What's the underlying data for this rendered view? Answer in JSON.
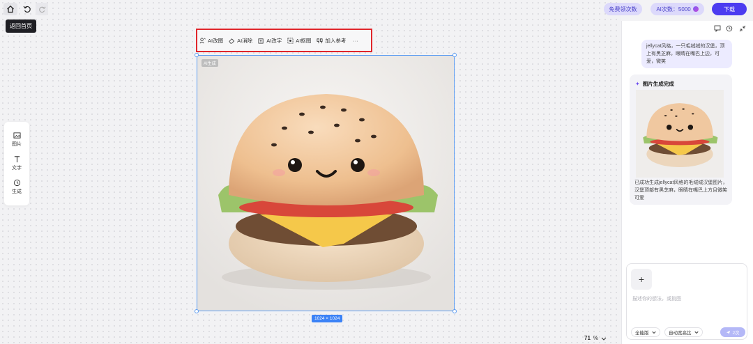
{
  "topbar": {
    "home_tooltip": "返回首页",
    "free_count_label": "免费领次数",
    "ai_count_label": "AI次数：5000",
    "download_label": "下载"
  },
  "toolbar": {
    "items": [
      {
        "label": "AI改图",
        "icon": "person-icon"
      },
      {
        "label": "AI消除",
        "icon": "eraser-icon"
      },
      {
        "label": "AI改字",
        "icon": "edit-text-icon"
      },
      {
        "label": "AI抠图",
        "icon": "cutout-icon"
      },
      {
        "label": "加入参考",
        "icon": "quote-icon"
      }
    ],
    "more": "···"
  },
  "canvas": {
    "ai_tag": "AI生成",
    "dimensions": "1024 × 1024"
  },
  "left_panel": {
    "items": [
      {
        "label": "图片",
        "icon": "image-icon"
      },
      {
        "label": "文字",
        "icon": "text-icon"
      },
      {
        "label": "生成",
        "icon": "history-icon"
      }
    ]
  },
  "zoom": {
    "value": "71",
    "unit": "%"
  },
  "chat": {
    "user_message": "jellycat风格，一只毛绒绒的汉堡，顶上有黑芝麻，眼睛在嘴巴上边，可爱，微笑",
    "ai_title": "图片生成完成",
    "ai_message": "已成功生成jellycat风格的毛绒绒汉堡图片，汉堡顶部有黑芝麻，眼睛在嘴巴上方且微笑可爱"
  },
  "input": {
    "placeholder": "描述你的想法，或挑图",
    "version_label": "全能版",
    "ratio_label": "自动宽高比",
    "send_label": "2次"
  },
  "colors": {
    "accent": "#4c3cf0",
    "selection": "#5b9cf2",
    "highlight_box": "#e0262b"
  }
}
